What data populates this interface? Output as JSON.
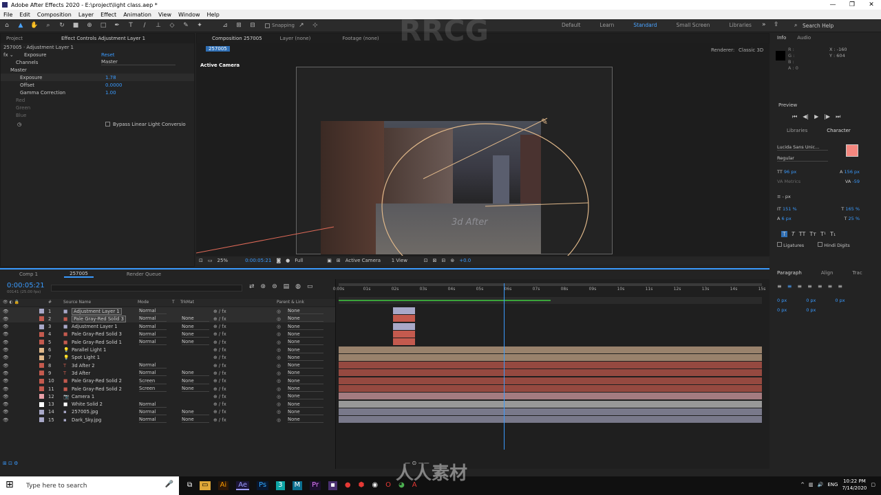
{
  "window": {
    "title": "Adobe After Effects 2020 - E:\\project\\light class.aep *"
  },
  "menu": [
    "File",
    "Edit",
    "Composition",
    "Layer",
    "Effect",
    "Animation",
    "View",
    "Window",
    "Help"
  ],
  "toolbar": {
    "snapping": "Snapping",
    "workspaces": [
      "Default",
      "Learn",
      "Standard",
      "Small Screen",
      "Libraries"
    ],
    "active_workspace": "Standard",
    "search": "Search Help"
  },
  "effect_controls": {
    "tabs": [
      "Project",
      "Effect Controls Adjustment Layer 1"
    ],
    "breadcrumb": "257005 · Adjustment Layer 1",
    "effect": "Exposure",
    "reset": "Reset",
    "channels_label": "Channels",
    "channels_value": "Master",
    "master": "Master",
    "params": [
      {
        "label": "Exposure",
        "value": "1.78"
      },
      {
        "label": "Offset",
        "value": "0.0000"
      },
      {
        "label": "Gamma Correction",
        "value": "1.00"
      }
    ],
    "channels": [
      "Red",
      "Green",
      "Blue"
    ],
    "bypass": "Bypass Linear Light Conversio"
  },
  "composition": {
    "tabs": [
      "Composition 257005",
      "Layer (none)",
      "Footage (none)"
    ],
    "comp_name": "257005",
    "renderer_label": "Renderer:",
    "renderer": "Classic 3D",
    "active_camera": "Active Camera",
    "zoom": "25%",
    "timecode": "0:00:05:21",
    "resolution": "Full",
    "view": "Active Camera",
    "views": "1 View",
    "exposure": "+0.0",
    "overlay": "3d After"
  },
  "info": {
    "tabs": [
      "Info",
      "Audio"
    ],
    "r": "R :",
    "g": "G :",
    "b": "B :",
    "a": "A : 0",
    "x": "X : -160",
    "y": "Y : 604"
  },
  "preview": {
    "title": "Preview"
  },
  "character": {
    "tabs": [
      "Libraries",
      "Character"
    ],
    "font": "Lucida Sans Unic...",
    "style": "Regular",
    "size": "96 px",
    "leading": "156 px",
    "kerning": "Metrics",
    "tracking": "-59",
    "stroke": "- px",
    "vscale": "151 %",
    "hscale": "165 %",
    "baseline": "6 px",
    "tsume": "25 %",
    "ligatures": "Ligatures",
    "hindi": "Hindi Digits",
    "text_color": "#f4877f"
  },
  "paragraph": {
    "tabs": [
      "Paragraph",
      "Align",
      "Trac"
    ],
    "vals": [
      "0 px",
      "0 px",
      "0 px",
      "0 px",
      "0 px"
    ]
  },
  "timeline": {
    "tabs": [
      "Comp 1",
      "257005",
      "Render Queue"
    ],
    "timecode": "0:00:05:21",
    "fps": "00141 (25.00 fps)",
    "columns": [
      "#",
      "Source Name",
      "Mode",
      "T",
      "TrkMat",
      "Parent & Link"
    ],
    "ruler": [
      "0:00s",
      "01s",
      "02s",
      "03s",
      "04s",
      "05s",
      "06s",
      "07s",
      "08s",
      "09s",
      "10s",
      "11s",
      "12s",
      "13s",
      "14s",
      "15s"
    ],
    "layers": [
      {
        "n": "1",
        "name": "Adjustment Layer 1",
        "mode": "Normal",
        "trk": "",
        "parent": "None",
        "color": "#a8a8c8",
        "icon": "solid"
      },
      {
        "n": "2",
        "name": "Pale Gray-Red Solid 3",
        "mode": "Normal",
        "trk": "None",
        "parent": "None",
        "color": "#c45a4e",
        "icon": "solid"
      },
      {
        "n": "3",
        "name": "Adjustment Layer 1",
        "mode": "Normal",
        "trk": "None",
        "parent": "None",
        "color": "#a8a8c8",
        "icon": "solid"
      },
      {
        "n": "4",
        "name": "Pale Gray-Red Solid 3",
        "mode": "Normal",
        "trk": "None",
        "parent": "None",
        "color": "#c45a4e",
        "icon": "solid"
      },
      {
        "n": "5",
        "name": "Pale Gray-Red Solid 1",
        "mode": "Normal",
        "trk": "None",
        "parent": "None",
        "color": "#c45a4e",
        "icon": "solid"
      },
      {
        "n": "6",
        "name": "Parallel Light 1",
        "mode": "",
        "trk": "",
        "parent": "None",
        "color": "#e0b88a",
        "icon": "light"
      },
      {
        "n": "7",
        "name": "Spot Light 1",
        "mode": "",
        "trk": "",
        "parent": "None",
        "color": "#e0b88a",
        "icon": "light"
      },
      {
        "n": "8",
        "name": "3d After 2",
        "mode": "Normal",
        "trk": "",
        "parent": "None",
        "color": "#c45a4e",
        "icon": "text"
      },
      {
        "n": "9",
        "name": "3d After",
        "mode": "Normal",
        "trk": "None",
        "parent": "None",
        "color": "#c45a4e",
        "icon": "text"
      },
      {
        "n": "10",
        "name": "Pale Gray-Red Solid 2",
        "mode": "Screen",
        "trk": "None",
        "parent": "None",
        "color": "#c45a4e",
        "icon": "solid"
      },
      {
        "n": "11",
        "name": "Pale Gray-Red Solid 2",
        "mode": "Screen",
        "trk": "None",
        "parent": "None",
        "color": "#c45a4e",
        "icon": "solid"
      },
      {
        "n": "12",
        "name": "Camera 1",
        "mode": "",
        "trk": "",
        "parent": "None",
        "color": "#e8a0a8",
        "icon": "camera"
      },
      {
        "n": "13",
        "name": "White Solid 2",
        "mode": "Normal",
        "trk": "",
        "parent": "None",
        "color": "#ffffff",
        "icon": "solid"
      },
      {
        "n": "14",
        "name": "257005.jpg",
        "mode": "Normal",
        "trk": "None",
        "parent": "None",
        "color": "#a8a8c8",
        "icon": "image"
      },
      {
        "n": "15",
        "name": "Dark_Sky.jpg",
        "mode": "Normal",
        "trk": "None",
        "parent": "None",
        "color": "#a8a8c8",
        "icon": "image"
      }
    ],
    "bar_colors": [
      "#a8a8c8",
      "#c45a4e",
      "#a8a8c8",
      "#c45a4e",
      "#c45a4e",
      "#c9a98a",
      "#c9a98a",
      "#c45a4e",
      "#c45a4e",
      "#c45a4e",
      "#c45a4e",
      "#d8a0a6",
      "#c8c8c8",
      "#9c9cb4",
      "#9c9cb4"
    ],
    "playhead_fraction": 0.39
  },
  "taskbar": {
    "search": "Type here to search",
    "lang": "ENG",
    "time": "10:22 PM",
    "date": "7/14/2020"
  },
  "watermarks": [
    "RRCG",
    "人人素材"
  ]
}
